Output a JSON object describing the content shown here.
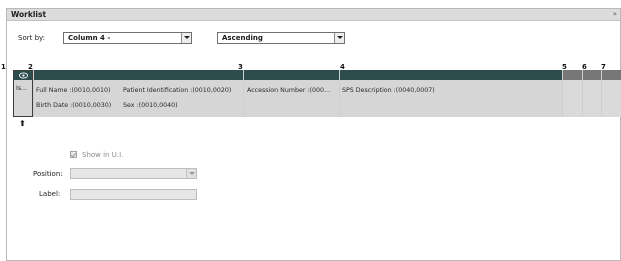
{
  "panel": {
    "title": "Worklist",
    "close_glyph": "»"
  },
  "sort": {
    "label": "Sort by:",
    "column_value": "Column 4 -",
    "order_value": "Ascending"
  },
  "column_numbers": [
    "1",
    "2",
    "3",
    "4",
    "5",
    "6",
    "7"
  ],
  "columns": {
    "col1": {
      "text": "Is...",
      "icon": "eye-icon"
    },
    "col2": {
      "line1a": "Full Name :(0010,0010)",
      "line1b": "Patient Identification :(0010,0020)",
      "line2a": "Birth Date :(0010,0030)",
      "line2b": "Sex :(0010,0040)"
    },
    "col3": {
      "line1": "Accession  Number :(000..."
    },
    "col4": {
      "line1": "SPS Description :(0040,0007)"
    }
  },
  "selected_column_indicator": "⬆",
  "properties": {
    "show_in_ui_label": "Show in U.I.",
    "show_in_ui_checked": true,
    "position_label": "Position:",
    "position_value": "",
    "label_label": "Label:",
    "label_value": ""
  }
}
